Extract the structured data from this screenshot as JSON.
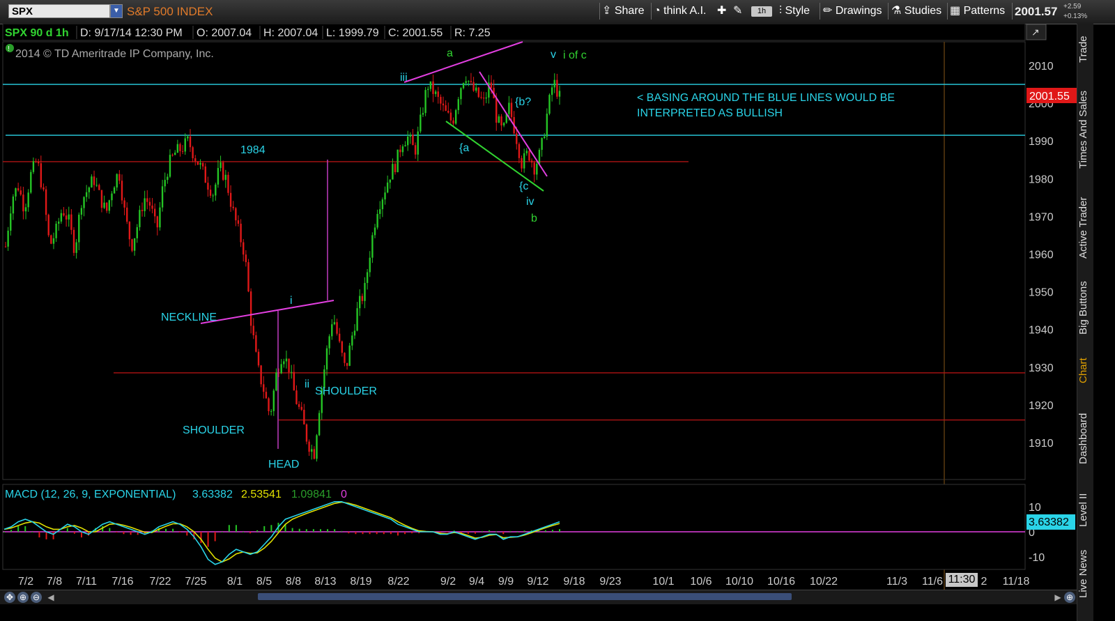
{
  "toolbar": {
    "symbol": "SPX",
    "index_name": "S&P 500 INDEX",
    "share_label": "Share",
    "thinkai_label": "think A.I.",
    "timeframe_label": "1h",
    "style_label": "Style",
    "drawings_label": "Drawings",
    "studies_label": "Studies",
    "patterns_label": "Patterns",
    "last_price": "2001.57",
    "change_abs": "+2.59",
    "change_pct": "+0.13%"
  },
  "header": {
    "symbol_period": "SPX 90 d 1h",
    "date": "D: 9/17/14 12:30 PM",
    "open": "O: 2007.04",
    "high": "H: 2007.04",
    "low": "L: 1999.79",
    "close": "C: 2001.55",
    "range": "R: 7.25",
    "copyright": "2014 © TD Ameritrade IP Company, Inc."
  },
  "right_tabs": [
    "Trade",
    "Times And Sales",
    "Active Trader",
    "Big Buttons",
    "Chart",
    "Dashboard",
    "Level II",
    "Live News"
  ],
  "colors": {
    "up": "#25c525",
    "down": "#e01818",
    "cyan": "#2ad4e8",
    "magenta": "#e23fe0",
    "red_line": "#b01414",
    "annotation_green": "#31d331",
    "price_tag": "#e01818"
  },
  "chart_data": [
    {
      "type": "candlestick",
      "title": "SPX 90 d 1h",
      "ylim": [
        1900,
        2016
      ],
      "y_ticks": [
        1910,
        1920,
        1930,
        1940,
        1950,
        1960,
        1970,
        1980,
        1990,
        2000,
        2010
      ],
      "x_tick_labels": [
        "7/2",
        "7/8",
        "7/11",
        "7/16",
        "7/22",
        "7/25",
        "8/1",
        "8/5",
        "8/8",
        "8/13",
        "8/19",
        "8/22",
        "9/2",
        "9/4",
        "9/9",
        "9/12",
        "9/18",
        "9/23",
        "10/1",
        "10/6",
        "10/10",
        "10/16",
        "10/22",
        "11/3",
        "11/6",
        "2",
        "11/18"
      ],
      "last_price_tag": "2001.55",
      "closes_approx": [
        1962,
        1975,
        1978,
        1972,
        1981,
        1985,
        1976,
        1962,
        1966,
        1972,
        1969,
        1961,
        1974,
        1977,
        1980,
        1975,
        1971,
        1978,
        1982,
        1970,
        1962,
        1968,
        1975,
        1973,
        1966,
        1978,
        1984,
        1987,
        1988,
        1990,
        1986,
        1983,
        1979,
        1976,
        1983,
        1980,
        1972,
        1966,
        1960,
        1942,
        1930,
        1924,
        1917,
        1928,
        1934,
        1930,
        1922,
        1917,
        1910,
        1907,
        1922,
        1934,
        1944,
        1936,
        1929,
        1938,
        1946,
        1950,
        1962,
        1972,
        1976,
        1981,
        1984,
        1990,
        1991,
        1987,
        1996,
        2005,
        2003,
        2000,
        1997,
        1995,
        2003,
        2008,
        2004,
        2002,
        2000,
        2006,
        1996,
        1992,
        1999,
        1992,
        1984,
        1987,
        1983,
        1987,
        1997,
        2006,
        2001.55
      ],
      "horizontal_lines": [
        {
          "value": 2005,
          "color": "cyan"
        },
        {
          "value": 1991.5,
          "color": "cyan"
        },
        {
          "value": 1984.5,
          "color": "red"
        },
        {
          "value": 1928.5,
          "color": "red"
        },
        {
          "value": 1916,
          "color": "red"
        }
      ],
      "annotations": [
        {
          "text": "1984",
          "color": "cyan"
        },
        {
          "text": "NECKLINE",
          "color": "cyan"
        },
        {
          "text": "SHOULDER",
          "color": "cyan"
        },
        {
          "text": "HEAD",
          "color": "cyan"
        },
        {
          "text": "SHOULDER",
          "color": "cyan"
        },
        {
          "text": "i",
          "color": "cyan"
        },
        {
          "text": "ii",
          "color": "cyan"
        },
        {
          "text": "iii",
          "color": "cyan"
        },
        {
          "text": "a",
          "color": "green"
        },
        {
          "text": "{a",
          "color": "cyan"
        },
        {
          "text": "{b?",
          "color": "cyan"
        },
        {
          "text": "{c",
          "color": "cyan"
        },
        {
          "text": "iv",
          "color": "cyan"
        },
        {
          "text": "b",
          "color": "green"
        },
        {
          "text": "v",
          "color": "cyan"
        },
        {
          "text": "i of c",
          "color": "green"
        },
        {
          "text": "< BASING AROUND THE BLUE LINES WOULD BE",
          "color": "cyan"
        },
        {
          "text": "INTERPRETED AS BULLISH",
          "color": "cyan"
        }
      ]
    },
    {
      "type": "line",
      "title": "MACD (12, 26, 9, EXPONENTIAL)",
      "legend_values": [
        "3.63382",
        "2.53541",
        "1.09841",
        "0"
      ],
      "ylim": [
        -14,
        14
      ],
      "y_ticks": [
        10,
        0,
        -10
      ],
      "last_value_tag": "3.63382",
      "macd": [
        1,
        2,
        4,
        5,
        4,
        2,
        0,
        -1,
        1,
        3,
        2,
        0,
        -1,
        1,
        3,
        4,
        3,
        2,
        1,
        0,
        -1,
        0,
        2,
        3,
        4,
        3,
        1,
        -2,
        -6,
        -11,
        -13,
        -12,
        -9,
        -7,
        -8,
        -9,
        -8,
        -5,
        -2,
        2,
        5,
        6,
        7,
        8,
        9,
        10,
        11,
        12,
        12,
        11,
        10,
        9,
        8,
        7,
        6,
        5,
        3,
        2,
        1,
        0,
        0,
        0,
        -1,
        -1,
        0,
        -1,
        -2,
        -3,
        -2,
        -1,
        -1,
        -3,
        -2,
        -2,
        -1,
        0,
        1,
        2,
        3,
        4
      ],
      "signal": [
        1,
        1.5,
        2.5,
        3.5,
        4,
        3.5,
        2,
        1,
        1,
        2,
        2.5,
        1.5,
        0,
        0,
        1.5,
        3,
        3.2,
        2.6,
        1.8,
        0.8,
        -0.2,
        -0.3,
        1,
        2.2,
        3.2,
        3.2,
        2,
        0,
        -3,
        -7,
        -10.5,
        -12,
        -10.8,
        -8.8,
        -8,
        -8.6,
        -8.4,
        -6.5,
        -3.8,
        -0.4,
        3,
        5,
        6.2,
        7.3,
        8.3,
        9.3,
        10.3,
        11.3,
        11.8,
        11.4,
        10.6,
        9.6,
        8.6,
        7.6,
        6.6,
        5.6,
        4,
        2.6,
        1.4,
        0.4,
        0.1,
        0,
        -0.6,
        -0.8,
        -0.3,
        -0.6,
        -1.5,
        -2.5,
        -2.2,
        -1.4,
        -1.1,
        -2.4,
        -2.2,
        -2,
        -1.3,
        -0.4,
        0.6,
        1.6,
        2.5,
        3.3
      ]
    }
  ]
}
